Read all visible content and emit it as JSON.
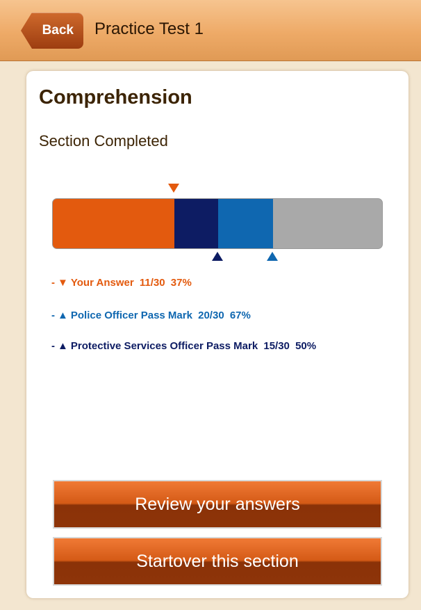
{
  "nav": {
    "back_label": "Back",
    "title": "Practice Test 1"
  },
  "section": {
    "title": "Comprehension",
    "status": "Section Completed"
  },
  "score_bar": {
    "total": 30,
    "your_score": 11,
    "protective_pass_mark": 15,
    "police_pass_mark": 20
  },
  "legend": [
    {
      "dash": "-",
      "symbol": "▼",
      "label": "Your Answer",
      "score": "11/30",
      "percent": "37%",
      "color": "#e35a0e"
    },
    {
      "dash": "-",
      "symbol": "▲",
      "label": "Police Officer Pass Mark",
      "score": "20/30",
      "percent": "67%",
      "color": "#0f67b0"
    },
    {
      "dash": "-",
      "symbol": "▲",
      "label": "Protective Services Officer Pass Mark",
      "score": "15/30",
      "percent": "50%",
      "color": "#0d1c63"
    }
  ],
  "buttons": {
    "review_label": "Review your answers",
    "startover_label": "Startover this section"
  },
  "colors": {
    "your_answer": "#e35a0e",
    "police": "#0f67b0",
    "protective": "#0d1c63",
    "remaining": "#a9a9a9"
  }
}
